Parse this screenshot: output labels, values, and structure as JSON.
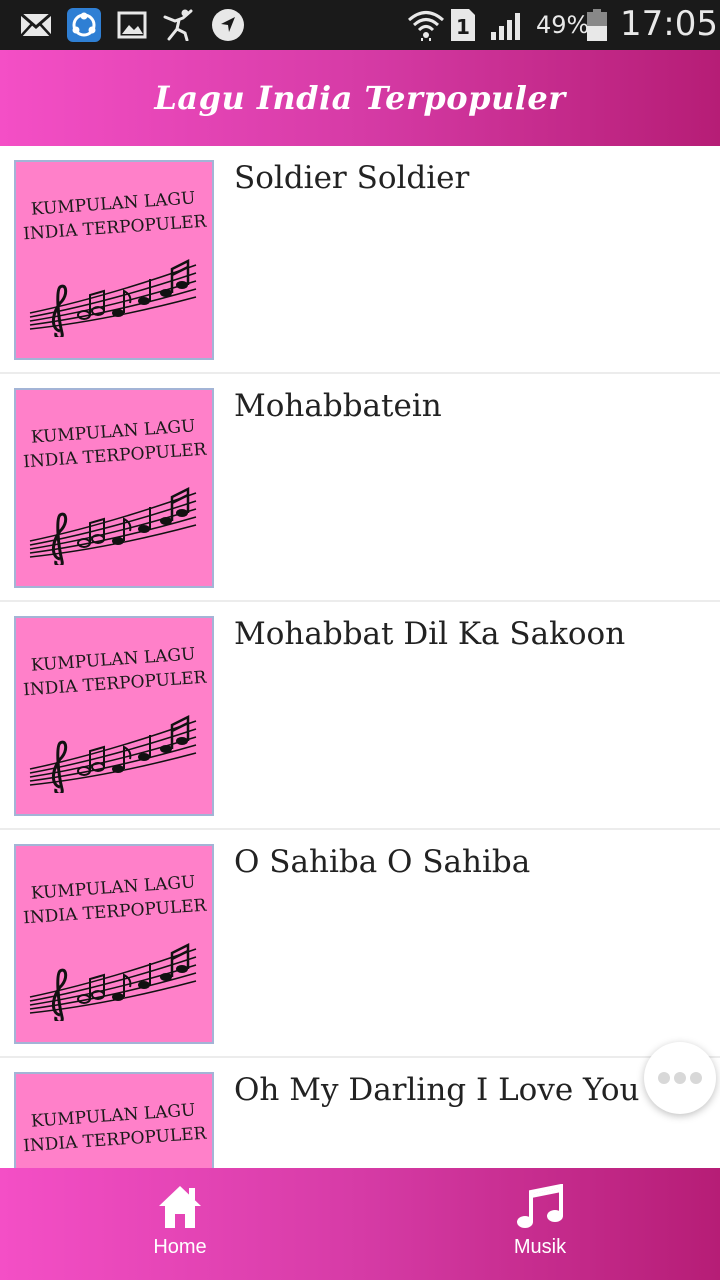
{
  "status_bar": {
    "icons": [
      "mail-icon",
      "shareit-icon",
      "gallery-icon",
      "fitness-icon",
      "navigation-icon",
      "wifi-icon",
      "sim-icon",
      "signal-icon",
      "battery-icon"
    ],
    "battery_percent": "49%",
    "time": "17:05"
  },
  "app_bar": {
    "title": "Lagu India Terpopuler"
  },
  "thumbnail": {
    "line1": "KUMPULAN LAGU",
    "line2": "INDIA TERPOPULER",
    "background_color": "#ff80c9"
  },
  "songs": [
    {
      "title": "Soldier Soldier"
    },
    {
      "title": "Mohabbatein"
    },
    {
      "title": "Mohabbat Dil Ka Sakoon"
    },
    {
      "title": "O Sahiba O Sahiba"
    },
    {
      "title": "Oh My Darling I Love You"
    }
  ],
  "fab": {
    "icon": "more-horizontal-icon"
  },
  "bottom_nav": {
    "items": [
      {
        "label": "Home",
        "icon": "home-icon"
      },
      {
        "label": "Musik",
        "icon": "music-note-icon"
      }
    ]
  },
  "colors": {
    "accent_start": "#f44fc6",
    "accent_end": "#b61d76",
    "status_bar": "#1a1a1a"
  }
}
